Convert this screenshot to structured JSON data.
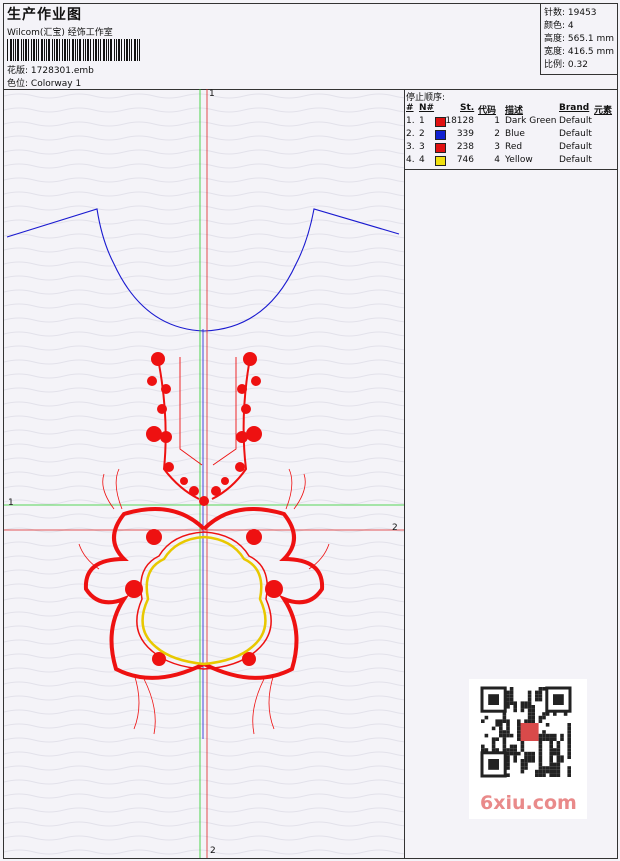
{
  "header": {
    "title": "生产作业图",
    "company": "Wilcom(汇宝) 经饰工作室",
    "pattern_label": "花版:",
    "pattern_value": "1728301.emb",
    "colorway_label": "色位:",
    "colorway_value": "Colorway 1"
  },
  "stats": {
    "stitches": "针数: 19453",
    "colors": "颜色: 4",
    "height": "高度: 565.1 mm",
    "width": "宽度: 416.5 mm",
    "scale": "比例: 0.32"
  },
  "legend": {
    "title": "停止顺序:",
    "headers": {
      "num": "#",
      "n": "N#",
      "st": "St.",
      "code": "代码",
      "desc": "描述",
      "brand": "Brand",
      "element": "元素"
    },
    "rows": [
      {
        "num": "1.",
        "n": "1",
        "color": "#e01010",
        "st": "18128",
        "code": "1",
        "desc": "Dark Green",
        "brand": "Default"
      },
      {
        "num": "2.",
        "n": "2",
        "color": "#1020d0",
        "st": "339",
        "code": "2",
        "desc": "Blue",
        "brand": "Default"
      },
      {
        "num": "3.",
        "n": "3",
        "color": "#e01010",
        "st": "238",
        "code": "3",
        "desc": "Red",
        "brand": "Default"
      },
      {
        "num": "4.",
        "n": "4",
        "color": "#f0e010",
        "st": "746",
        "code": "4",
        "desc": "Yellow",
        "brand": "Default"
      }
    ]
  },
  "axes": {
    "top_label": "1",
    "green_label": "1",
    "red_right_label": "2",
    "red_bottom_label": "2"
  },
  "watermark": "6xiu.com",
  "colors": {
    "stitch_red": "#ee1111",
    "outline_blue": "#1a1ad0",
    "guide_green": "#22cc22",
    "guide_red": "#dd2222",
    "thread_yellow": "#e8c800"
  }
}
